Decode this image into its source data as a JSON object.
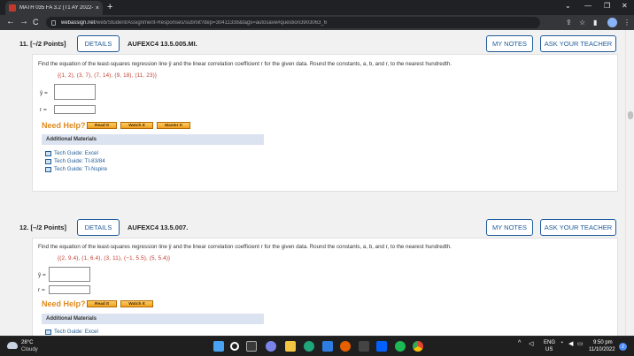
{
  "browser": {
    "tab_title": "MATH 035 FA 3.2 (T1 AY 2022-2(",
    "tab_close": "×",
    "new_tab": "+",
    "url_host": "webassign.net",
    "url_path": "/web/Student/Assignment-Responses/submit?dep=30411338&tags=autosave#question3903063_6",
    "nav_back": "←",
    "nav_forward": "→",
    "nav_reload": "C",
    "win_min": "—",
    "win_restore": "❐",
    "win_close": "✕",
    "win_chevron": "⌄"
  },
  "questions": [
    {
      "number": "11.",
      "points": "[–/2 Points]",
      "details_label": "DETAILS",
      "code": "AUFEXC4 13.5.005.MI.",
      "my_notes_label": "MY NOTES",
      "ask_teacher_label": "ASK YOUR TEACHER",
      "prompt": "Find the equation of the least-squares regression line ŷ and the linear correlation coefficient r for the given data. Round the constants, a, b, and r, to the nearest hundredth.",
      "dataset": "{(1, 2), (3, 7), (7, 14), (9, 18), (11, 23)}",
      "yhat_label": "ŷ =",
      "r_label": "r =",
      "need_help": "Need Help?",
      "help_buttons": [
        "Read It",
        "Watch It",
        "Master It"
      ],
      "additional_materials": "Additional Materials",
      "guides": [
        "Tech Guide: Excel",
        "Tech Guide: TI-83/84",
        "Tech Guide: TI-Nspire"
      ]
    },
    {
      "number": "12.",
      "points": "[–/2 Points]",
      "details_label": "DETAILS",
      "code": "AUFEXC4 13.5.007.",
      "my_notes_label": "MY NOTES",
      "ask_teacher_label": "ASK YOUR TEACHER",
      "prompt": "Find the equation of the least-squares regression line ŷ and the linear correlation coefficient r for the given data. Round the constants, a, b, and r, to the nearest hundredth.",
      "dataset": "{(2, 9.4), (1, 6.4), (3, 11), (−1, 5.5), (5, 5.4)}",
      "yhat_label": "ŷ =",
      "r_label": "r =",
      "need_help": "Need Help?",
      "help_buttons": [
        "Read It",
        "Watch It"
      ],
      "additional_materials": "Additional Materials",
      "guides": [
        "Tech Guide: Excel"
      ]
    }
  ],
  "taskbar": {
    "temperature": "28°C",
    "condition": "Cloudy",
    "lang_top": "ENG",
    "lang_bottom": "US",
    "time": "9:50 pm",
    "date": "11/10/2022",
    "notifications": "2"
  },
  "colors": {
    "accent_blue": "#1f5c99",
    "dataset_red": "#c0392b",
    "need_help_orange": "#e08a1e"
  }
}
